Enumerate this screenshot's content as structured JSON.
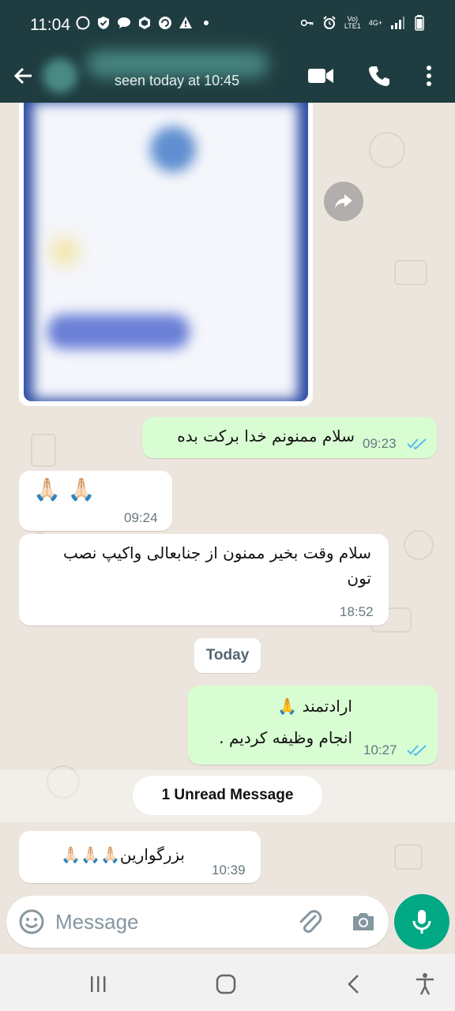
{
  "status_bar": {
    "time": "11:04",
    "network_top": "Vo)",
    "network_bottom": "LTE1",
    "signal_label": "4G+"
  },
  "header": {
    "contact_status": "seen today at 10:45"
  },
  "messages": [
    {
      "id": "m1",
      "direction": "out",
      "text": "سلام ممنونم خدا برکت بده",
      "time": "09:23",
      "read": true
    },
    {
      "id": "m2",
      "direction": "in",
      "text": "🙏🏻 🙏🏻",
      "time": "09:24"
    },
    {
      "id": "m3",
      "direction": "in",
      "text": "سلام وقت بخیر ممنون از جنابعالی واکیپ نصب تون",
      "time": "18:52"
    },
    {
      "id": "m4",
      "direction": "out",
      "text": "ارادتمند 🙏\nانجام وظیفه کردیم .",
      "line1": "ارادتمند 🙏",
      "line2": "انجام وظیفه کردیم .",
      "time": "10:27",
      "read": true
    },
    {
      "id": "m5",
      "direction": "in",
      "text": "بزرگوارین🙏🏻🙏🏻🙏🏻",
      "time": "10:39"
    }
  ],
  "date_divider": "Today",
  "unread_divider": "1 Unread Message",
  "composer": {
    "placeholder": "Message"
  },
  "colors": {
    "header_bg": "#1f3d40",
    "chat_bg": "#ece5dd",
    "outgoing_bubble": "#d9fdd3",
    "incoming_bubble": "#ffffff",
    "accent": "#00a884",
    "read_tick": "#53bdeb"
  },
  "icons": {
    "status_bar": [
      "whatsapp-icon",
      "shield-check-icon",
      "chat-icon",
      "hexagon-icon",
      "sync-icon",
      "warning-icon",
      "key-icon",
      "alarm-icon",
      "signal-icon",
      "battery-icon"
    ],
    "header": [
      "back-arrow-icon",
      "video-call-icon",
      "phone-icon",
      "more-vert-icon"
    ],
    "composer": [
      "emoji-icon",
      "attach-icon",
      "camera-icon",
      "mic-icon"
    ],
    "navbar": [
      "recents-icon",
      "home-icon",
      "back-icon",
      "accessibility-icon"
    ]
  }
}
